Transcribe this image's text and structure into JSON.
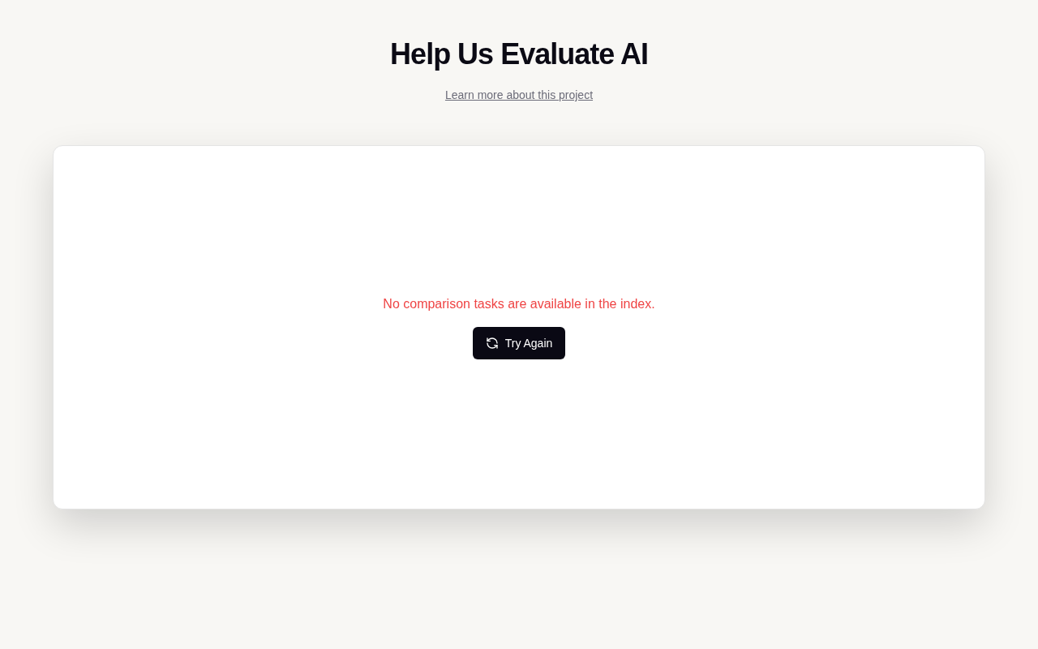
{
  "header": {
    "title": "Help Us Evaluate AI",
    "link": "Learn more about this project"
  },
  "card": {
    "error_message": "No comparison tasks are available in the index.",
    "button": {
      "label": "Try Again"
    }
  }
}
